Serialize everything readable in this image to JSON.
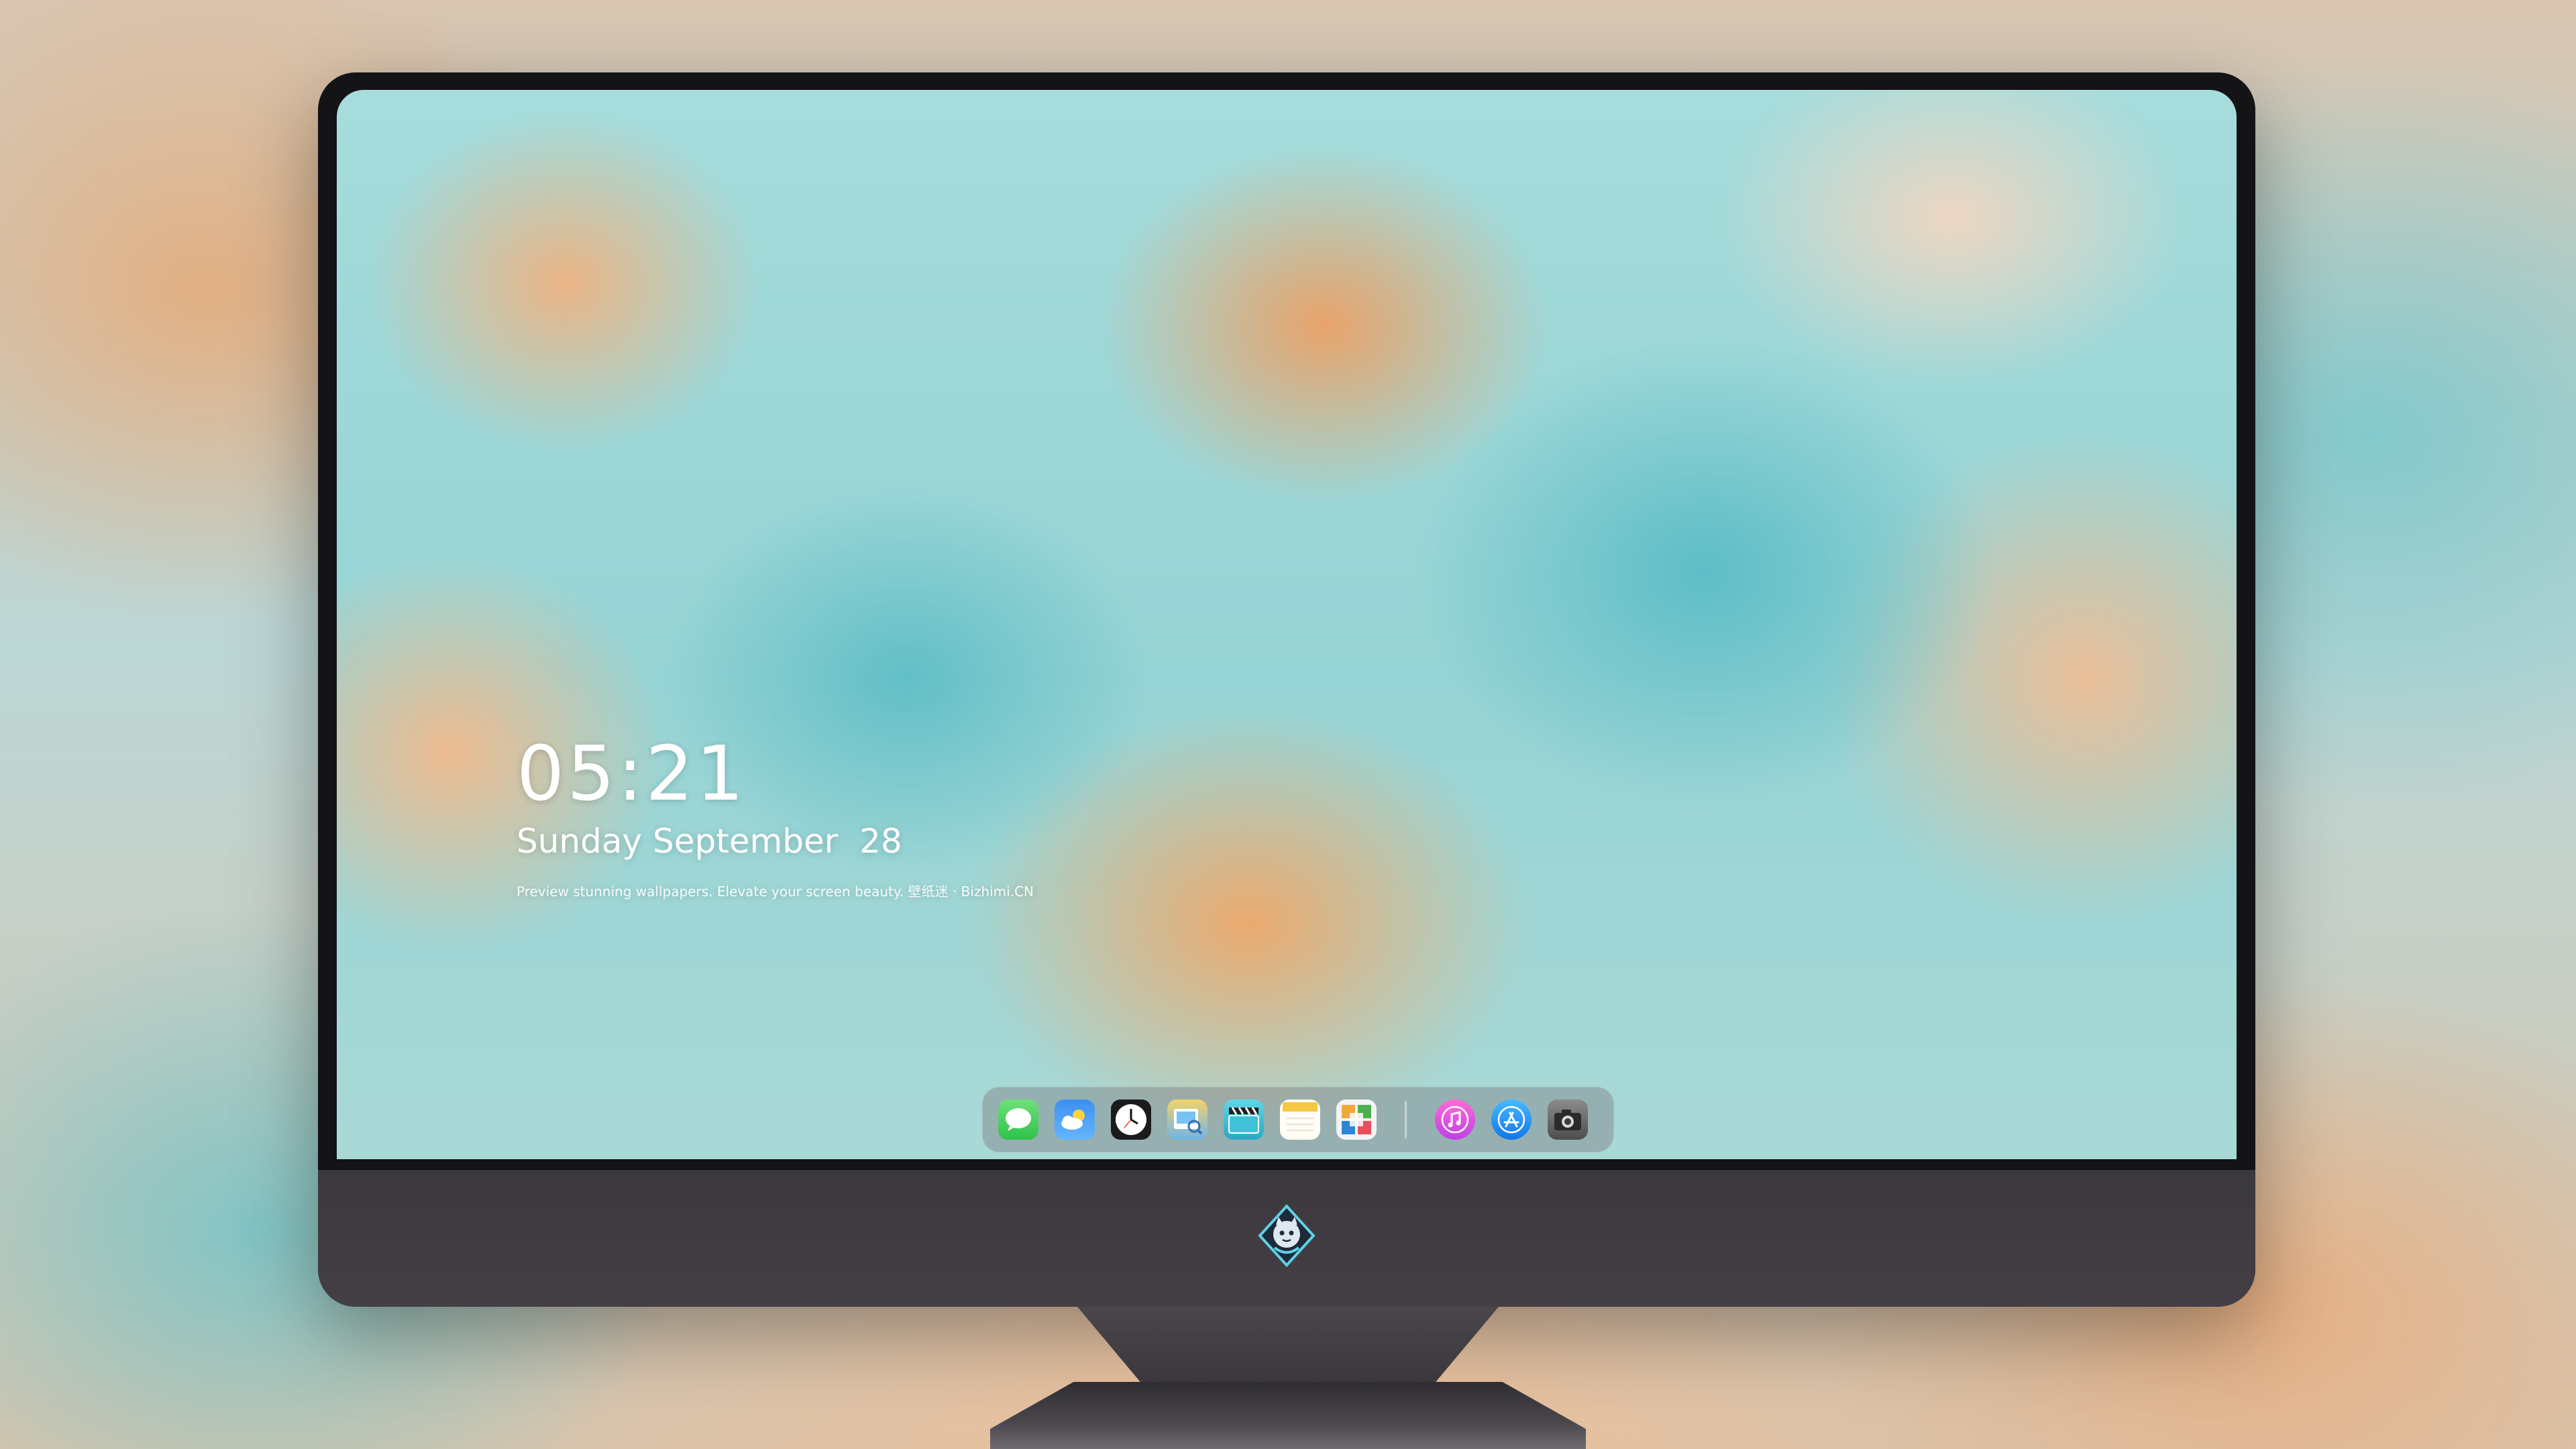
{
  "lockscreen": {
    "time": "05:21",
    "date": "Sunday September  28",
    "tagline": "Preview stunning wallpapers. Elevate your screen beauty. 壁纸迷 · Bizhimi.CN"
  },
  "dock": {
    "apps": [
      {
        "name": "Messages",
        "icon": "messages-icon"
      },
      {
        "name": "Weather",
        "icon": "weather-icon"
      },
      {
        "name": "Clock",
        "icon": "clock-icon"
      },
      {
        "name": "Preview",
        "icon": "preview-icon"
      },
      {
        "name": "Video",
        "icon": "clapperboard-icon"
      },
      {
        "name": "Notes",
        "icon": "notes-icon"
      },
      {
        "name": "Photos",
        "icon": "photos-icon"
      },
      {
        "name": "Music",
        "icon": "music-icon"
      },
      {
        "name": "App Store",
        "icon": "app-store-icon"
      },
      {
        "name": "Camera",
        "icon": "camera-icon"
      }
    ]
  },
  "colors": {
    "wallpaper_teal": "#96d3d4",
    "wallpaper_orange": "#eca064",
    "bezel": "#141316",
    "chin": "#3e3a3f"
  }
}
